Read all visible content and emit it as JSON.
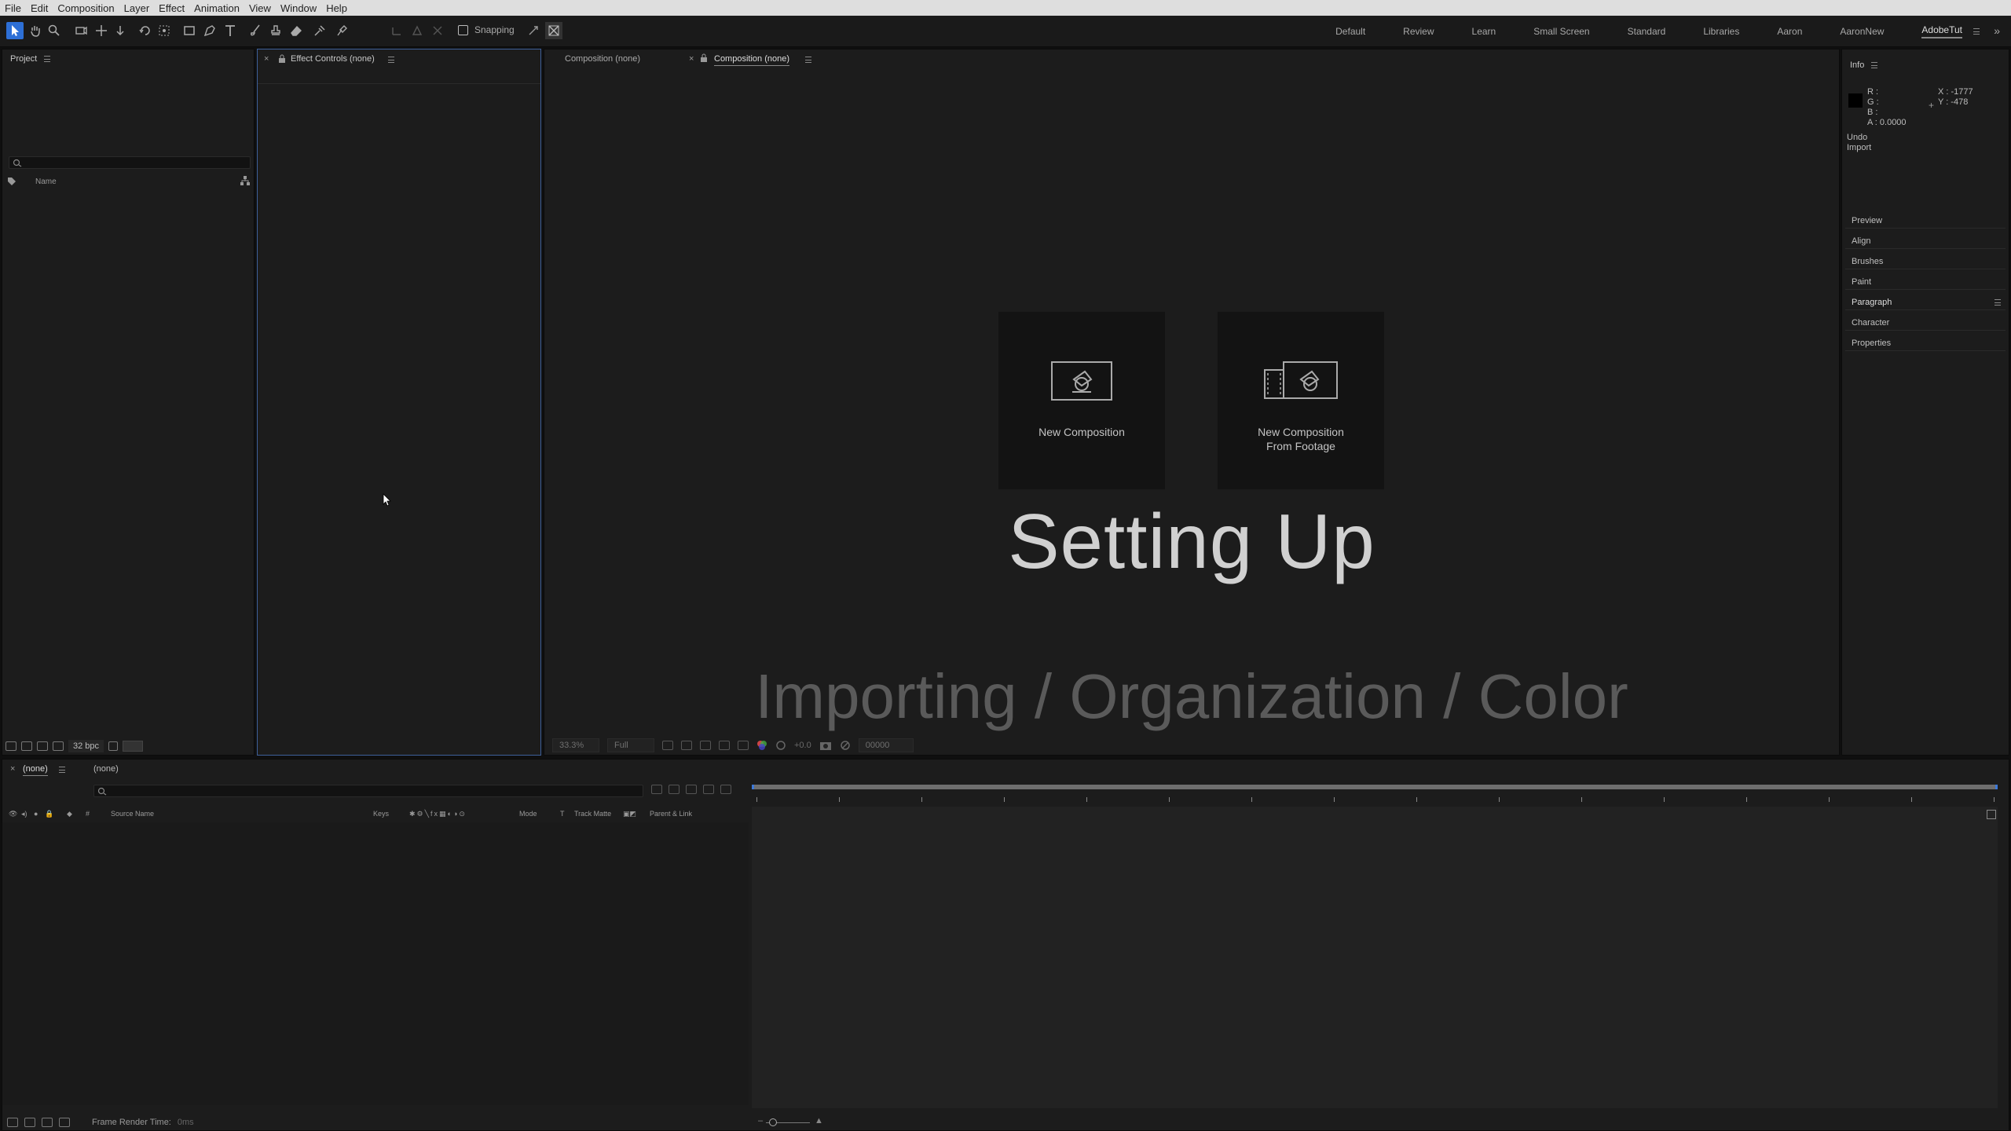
{
  "menu": [
    "File",
    "Edit",
    "Composition",
    "Layer",
    "Effect",
    "Animation",
    "View",
    "Window",
    "Help"
  ],
  "toolbar": {
    "snapping_label": "Snapping",
    "workspaces": [
      "Default",
      "Review",
      "Learn",
      "Small Screen",
      "Standard",
      "Libraries",
      "Aaron",
      "AaronNew",
      "AdobeTut"
    ],
    "current_workspace": "AdobeTut",
    "more": "»"
  },
  "project": {
    "title": "Project",
    "name_column": "Name",
    "bpc": "32 bpc"
  },
  "effect_controls": {
    "title": "Effect Controls (none)"
  },
  "composition": {
    "tab1": "Composition (none)",
    "tab2": "Composition (none)",
    "card1_label": "New Composition",
    "card2_label_line1": "New Composition",
    "card2_label_line2": "From Footage",
    "overlay_title": "Setting Up",
    "overlay_subtitle": "Importing / Organization / Color",
    "zoom": "33.3%",
    "resolution": "Full",
    "exposure": "+0.0",
    "timecode": "00000"
  },
  "info": {
    "title": "Info",
    "r": "R :",
    "g": "G :",
    "b": "B :",
    "a": "A : 0.0000",
    "x": "X : -1777",
    "y": "Y : -478",
    "undo_line1": "Undo",
    "undo_line2": "Import",
    "side_panels": [
      "Preview",
      "Align",
      "Brushes",
      "Paint",
      "Paragraph",
      "Character",
      "Properties"
    ]
  },
  "timeline": {
    "tab1": "(none)",
    "tab2": "(none)",
    "col_hash": "#",
    "col_source": "Source Name",
    "col_keys": "Keys",
    "col_mode": "Mode",
    "col_t": "T",
    "col_trackmatte": "Track Matte",
    "col_parent": "Parent & Link",
    "frame_render_label": "Frame Render Time:",
    "frame_render_value": "0ms"
  },
  "colors": {
    "accent_blue": "#2d6fd6",
    "panel_bg": "#1c1c1c",
    "overlay_text": "#d0d0d0",
    "subtitle_text": "#5a5a5a"
  }
}
